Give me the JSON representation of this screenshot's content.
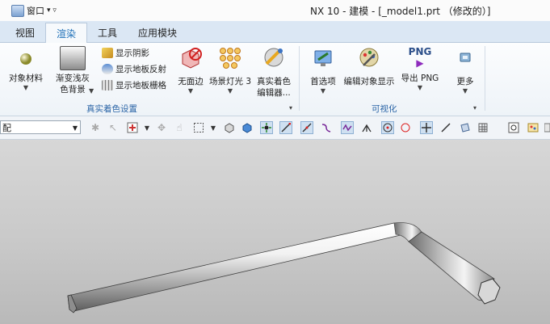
{
  "window": {
    "quick_menu_label": "窗口",
    "quick_menu_arrows": "▾ ▿",
    "title": "NX 10 - 建模 - [_model1.prt （修改的）]"
  },
  "tabs": [
    "视图",
    "渲染",
    "工具",
    "应用模块"
  ],
  "active_tab": "渲染",
  "ribbon": {
    "object_material": "对象材料",
    "gradient_bg_line1": "渐变浅灰",
    "gradient_bg_line2": "色背景",
    "show_shadow": "显示阴影",
    "show_floor_reflection": "显示地板反射",
    "show_floor_grid": "显示地板栅格",
    "no_face_edges": "无面边",
    "scene_lights": "场景灯光 3",
    "true_shading_editor_line1": "真实着色",
    "true_shading_editor_line2": "编辑器...",
    "group_true_shading": "真实着色设置",
    "preferences": "首选项",
    "edit_object_display": "编辑对象显示",
    "export_png": "导出 PNG",
    "png_badge": "PNG",
    "more": "更多",
    "group_visualization": "可视化"
  },
  "toolbar": {
    "selection_filter_value": "配"
  },
  "colors": {
    "accent": "#1d6fb8",
    "tab_bar": "#dbe7f4",
    "viewport_top": "#d7d7d7",
    "viewport_bottom": "#b9b9b9"
  }
}
